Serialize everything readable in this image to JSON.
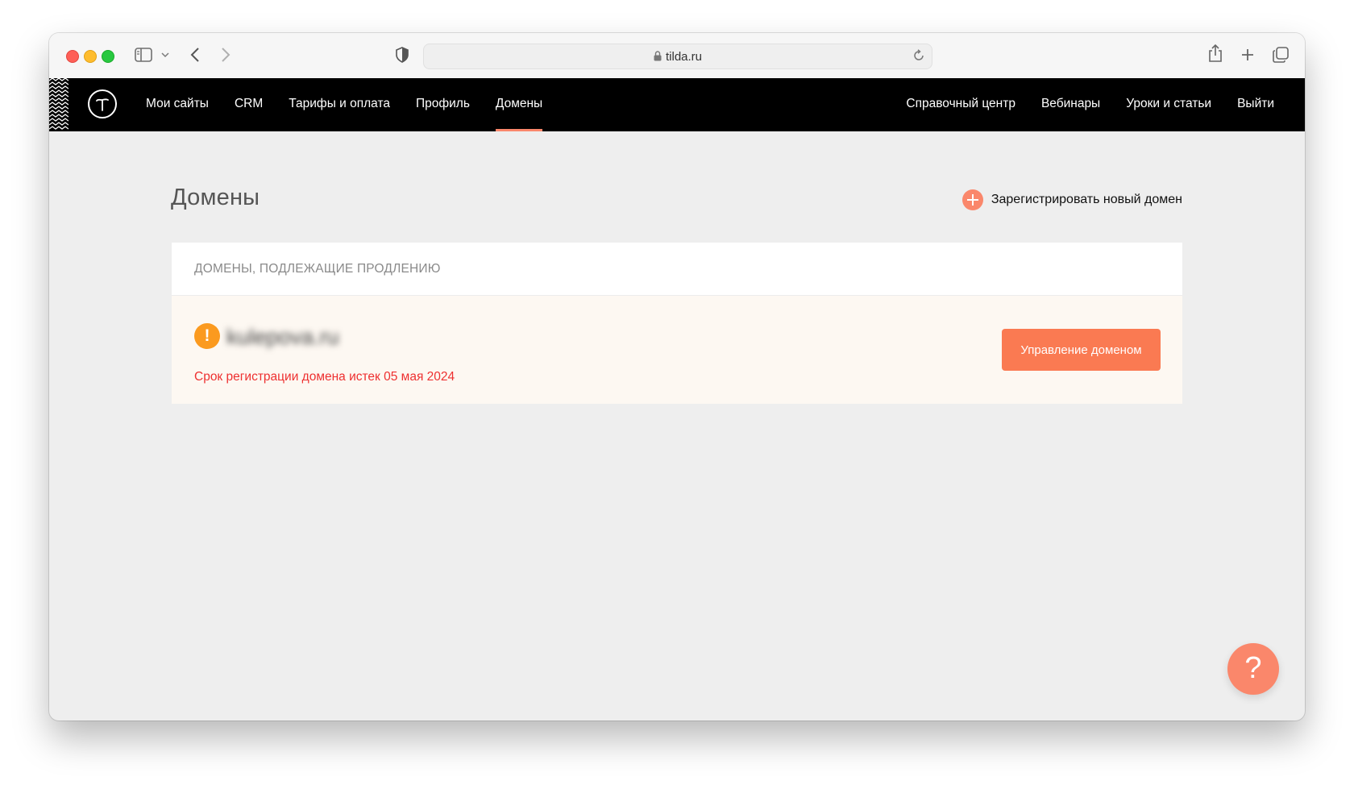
{
  "browser": {
    "url": "tilda.ru",
    "icons": [
      "sidebar-icon",
      "chevron-down-icon",
      "back-icon",
      "forward-icon",
      "shield-icon",
      "lock-icon",
      "reload-icon",
      "share-icon",
      "new-tab-icon",
      "tabs-overview-icon"
    ]
  },
  "nav": {
    "left": [
      "Мои сайты",
      "CRM",
      "Тарифы и оплата",
      "Профиль",
      "Домены"
    ],
    "right": [
      "Справочный центр",
      "Вебинары",
      "Уроки и статьи",
      "Выйти"
    ],
    "active": "Домены"
  },
  "page": {
    "title": "Домены",
    "register_label": "Зарегистрировать новый домен"
  },
  "domains_card": {
    "header": "ДОМЕНЫ, ПОДЛЕЖАЩИЕ ПРОДЛЕНИЮ",
    "items": [
      {
        "domain": "kulepova.ru",
        "warning": "!",
        "status": "Срок регистрации домена истек 05 мая 2024",
        "action_label": "Управление доменом"
      }
    ]
  },
  "help": {
    "label": "?"
  },
  "colors": {
    "accent": "#fa876b",
    "button": "#fa7a52",
    "warning": "#fb9a1f",
    "error_text": "#ee3030",
    "navbar": "#000000",
    "page_bg": "#eeeeee"
  }
}
